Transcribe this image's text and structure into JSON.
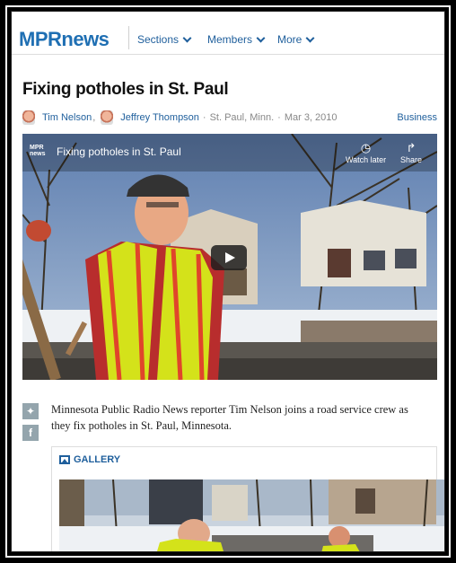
{
  "header": {
    "logo_mpr": "MPR",
    "logo_news": "news",
    "nav": [
      {
        "label": "Sections"
      },
      {
        "label": "Members"
      },
      {
        "label": "More"
      }
    ]
  },
  "article": {
    "title": "Fixing potholes in St. Paul",
    "authors": [
      "Tim Nelson",
      "Jeffrey Thompson"
    ],
    "author_separator": ",",
    "location": "St. Paul, Minn.",
    "date": "Mar 3, 2010",
    "category": "Business"
  },
  "video": {
    "title": "Fixing potholes in St. Paul",
    "logo_top": "MPR",
    "logo_bottom": "news",
    "watch_later": "Watch later",
    "share": "Share"
  },
  "caption": "Minnesota Public Radio News reporter Tim Nelson joins a road service crew as they fix potholes in St. Paul, Minnesota.",
  "gallery": {
    "heading": "GALLERY"
  },
  "colors": {
    "brand": "#1f6fb3",
    "link": "#1f5f9c",
    "vest": "#d4e21a"
  }
}
